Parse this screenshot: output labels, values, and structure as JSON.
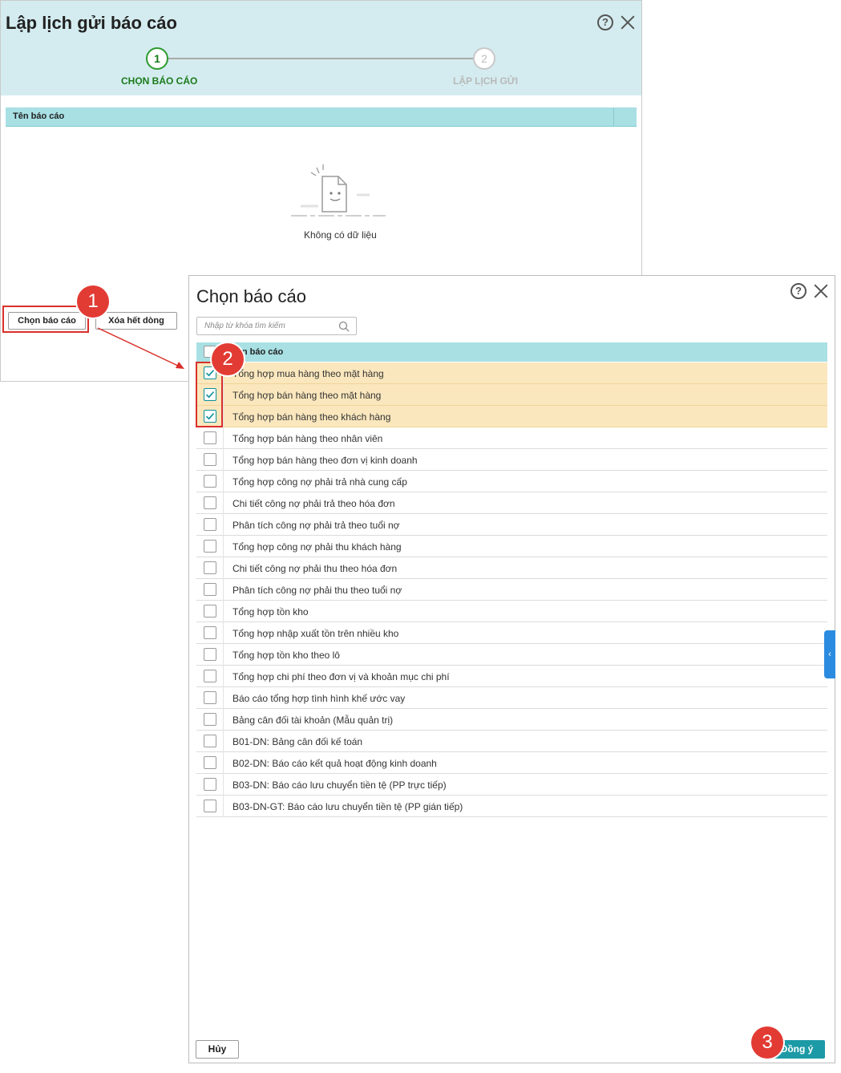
{
  "schedule_dialog": {
    "title": "Lập lịch gửi báo cáo",
    "help_icon": "?",
    "steps": [
      {
        "number": "1",
        "label": "CHỌN BÁO CÁO"
      },
      {
        "number": "2",
        "label": "LẬP LỊCH GỬI"
      }
    ],
    "grid_header": "Tên báo cáo",
    "empty_text": "Không có dữ liệu",
    "choose_button": "Chọn báo cáo",
    "clear_button": "Xóa hết dòng"
  },
  "choose_dialog": {
    "title": "Chọn báo cáo",
    "help_icon": "?",
    "search_placeholder": "Nhập từ khóa tìm kiếm",
    "grid_header": "Tên báo cáo",
    "rows": [
      {
        "label": "Tổng hợp mua hàng theo mặt hàng",
        "checked": true
      },
      {
        "label": "Tổng hợp bán hàng theo mặt hàng",
        "checked": true
      },
      {
        "label": "Tổng hợp bán hàng theo khách hàng",
        "checked": true
      },
      {
        "label": "Tổng hợp bán hàng theo nhân viên",
        "checked": false
      },
      {
        "label": "Tổng hợp bán hàng theo đơn vị kinh doanh",
        "checked": false
      },
      {
        "label": "Tổng hợp công nợ phải trả nhà cung cấp",
        "checked": false
      },
      {
        "label": "Chi tiết công nợ phải trả theo hóa đơn",
        "checked": false
      },
      {
        "label": "Phân tích công nợ phải trả theo tuổi nợ",
        "checked": false
      },
      {
        "label": "Tổng hợp công nợ phải thu khách hàng",
        "checked": false
      },
      {
        "label": "Chi tiết công nợ phải thu theo hóa đơn",
        "checked": false
      },
      {
        "label": "Phân tích công nợ phải thu theo tuổi nợ",
        "checked": false
      },
      {
        "label": "Tổng hợp tồn kho",
        "checked": false
      },
      {
        "label": "Tổng hợp nhập xuất tồn trên nhiều kho",
        "checked": false
      },
      {
        "label": "Tổng hợp tồn kho theo lô",
        "checked": false
      },
      {
        "label": "Tổng hợp chi phí theo đơn vị và khoản mục chi phí",
        "checked": false
      },
      {
        "label": "Báo cáo tổng hợp tình hình khế ước vay",
        "checked": false
      },
      {
        "label": "Bảng cân đối tài khoản (Mẫu quản trị)",
        "checked": false
      },
      {
        "label": "B01-DN: Bảng cân đối kế toán",
        "checked": false
      },
      {
        "label": "B02-DN: Báo cáo kết quả hoạt động kinh doanh",
        "checked": false
      },
      {
        "label": "B03-DN: Báo cáo lưu chuyển tiền tệ (PP trực tiếp)",
        "checked": false
      },
      {
        "label": "B03-DN-GT: Báo cáo lưu chuyển tiền tệ (PP gián tiếp)",
        "checked": false
      }
    ],
    "side_tab_icon": "‹",
    "cancel_button": "Hủy",
    "ok_button": "Đồng ý"
  },
  "callouts": [
    "1",
    "2",
    "3"
  ],
  "colors": {
    "header_bg": "#d4ecf0",
    "grid_header_bg": "#a8e0e4",
    "selected_row_bg": "#fbe7bd",
    "accent": "#1c9aa6",
    "step_active": "#1a7a1a",
    "callout": "#e23b34"
  }
}
